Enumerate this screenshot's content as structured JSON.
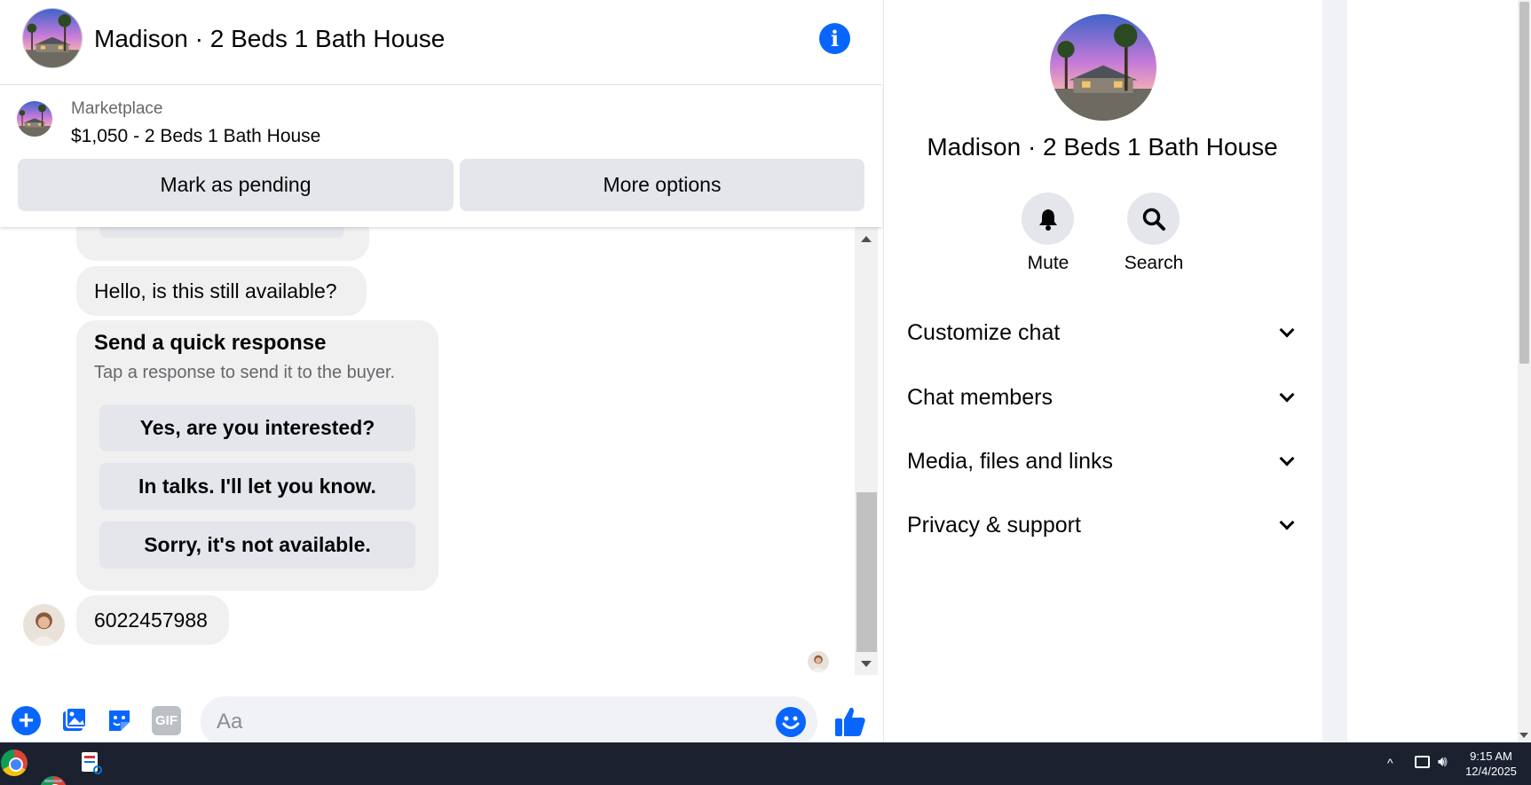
{
  "chat": {
    "title": "Madison · 2 Beds 1 Bath House",
    "listing": {
      "source": "Marketplace",
      "price_title": "$1,050 - 2 Beds 1 Bath House",
      "pending_label": "Mark as pending",
      "more_label": "More options"
    },
    "messages": {
      "hello": "Hello, is this still available?",
      "quick_title": "Send a quick response",
      "quick_subtitle": "Tap a response to send it to the buyer.",
      "quick_replies": [
        "Yes, are you interested?",
        "In talks. I'll let you know.",
        "Sorry, it's not available."
      ],
      "phone": "6022457988"
    },
    "composer": {
      "placeholder": "Aa",
      "gif_label": "GIF"
    }
  },
  "panel": {
    "name": "Madison · 2 Beds 1 Bath House",
    "mute_label": "Mute",
    "search_label": "Search",
    "sections": [
      "Customize chat",
      "Chat members",
      "Media, files and links",
      "Privacy & support"
    ]
  },
  "taskbar": {
    "time": "9:15 AM",
    "date": "12/4/2025"
  },
  "colors": {
    "accent": "#0866ff",
    "button_grey": "#e4e6eb",
    "bubble_grey": "#f0f0f0",
    "taskbar": "#1c2130"
  }
}
